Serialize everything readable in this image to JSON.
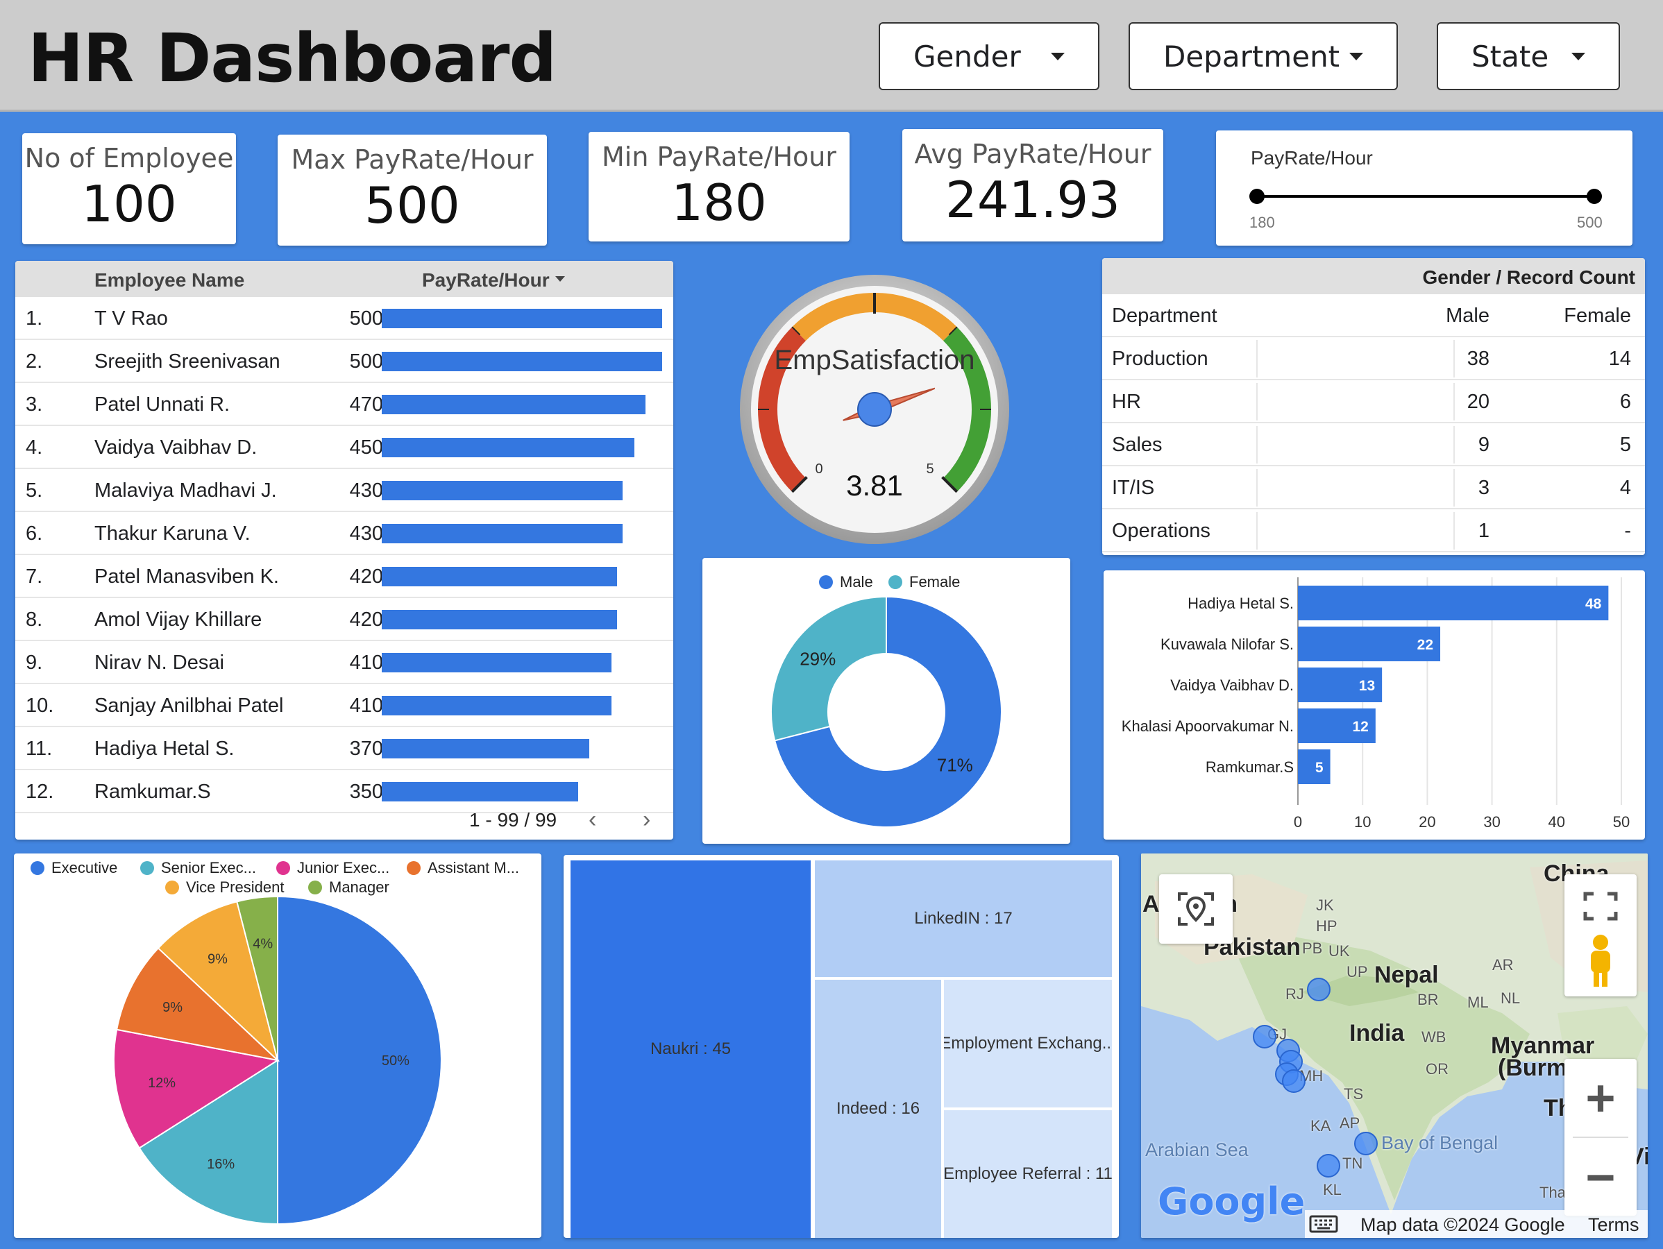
{
  "header": {
    "title": "HR Dashboard",
    "filters": [
      {
        "label": "Gender"
      },
      {
        "label": "Department"
      },
      {
        "label": "State"
      }
    ]
  },
  "kpis": [
    {
      "label": "No of Employee",
      "value": "100"
    },
    {
      "label": "Max PayRate/Hour",
      "value": "500"
    },
    {
      "label": "Min PayRate/Hour",
      "value": "180"
    },
    {
      "label": "Avg PayRate/Hour",
      "value": "241.93"
    }
  ],
  "slider": {
    "label": "PayRate/Hour",
    "min": "180",
    "max": "500"
  },
  "pay_table": {
    "col_name": "Employee Name",
    "col_pay": "PayRate/Hour",
    "sort_icon": "caret-down-icon",
    "max_value": 500,
    "rows": [
      {
        "no": "1.",
        "name": "T V Rao",
        "pay": 500
      },
      {
        "no": "2.",
        "name": "Sreejith Sreenivasan",
        "pay": 500
      },
      {
        "no": "3.",
        "name": "Patel Unnati R.",
        "pay": 470
      },
      {
        "no": "4.",
        "name": "Vaidya Vaibhav D.",
        "pay": 450
      },
      {
        "no": "5.",
        "name": "Malaviya Madhavi J.",
        "pay": 430
      },
      {
        "no": "6.",
        "name": "Thakur Karuna V.",
        "pay": 430
      },
      {
        "no": "7.",
        "name": "Patel Manasviben K.",
        "pay": 420
      },
      {
        "no": "8.",
        "name": "Amol Vijay Khillare",
        "pay": 420
      },
      {
        "no": "9.",
        "name": "Nirav N. Desai",
        "pay": 410
      },
      {
        "no": "10.",
        "name": "Sanjay Anilbhai Patel",
        "pay": 410
      },
      {
        "no": "11.",
        "name": "Hadiya Hetal S.",
        "pay": 370
      },
      {
        "no": "12.",
        "name": "Ramkumar.S",
        "pay": 350
      }
    ],
    "pagination": "1 - 99 / 99"
  },
  "gauge": {
    "label": "EmpSatisfaction",
    "value": 3.81,
    "value_text": "3.81",
    "min": "0",
    "max": "5",
    "colors": [
      "#d0432b",
      "#f0a030",
      "#43a035"
    ]
  },
  "gender_table": {
    "header": "Gender / Record Count",
    "col_dept": "Department",
    "col_male": "Male",
    "col_female": "Female",
    "rows": [
      {
        "dept": "Production",
        "male": "38",
        "female": "14"
      },
      {
        "dept": "HR",
        "male": "20",
        "female": "6"
      },
      {
        "dept": "Sales",
        "male": "9",
        "female": "5"
      },
      {
        "dept": "IT/IS",
        "male": "3",
        "female": "4"
      },
      {
        "dept": "Operations",
        "male": "1",
        "female": "-"
      }
    ]
  },
  "chart_data": [
    {
      "type": "pie",
      "variant": "donut",
      "legend_position": "top",
      "labels": [
        "Male",
        "Female"
      ],
      "values": [
        71,
        29
      ],
      "value_labels": [
        "71%",
        "29%"
      ],
      "colors": [
        "#3477e0",
        "#4fb3c8"
      ]
    },
    {
      "type": "bar",
      "orientation": "horizontal",
      "categories": [
        "Hadiya Hetal S.",
        "Kuvawala Nilofar S.",
        "Vaidya Vaibhav D.",
        "Khalasi Apoorvakumar N.",
        "Ramkumar.S"
      ],
      "values": [
        48,
        22,
        13,
        12,
        5
      ],
      "xlim": [
        0,
        50
      ],
      "xticks": [
        "0",
        "10",
        "20",
        "30",
        "40",
        "50"
      ],
      "grid": true,
      "color": "#3477e0"
    },
    {
      "type": "pie",
      "legend_position": "top",
      "labels": [
        "Executive",
        "Senior Exec...",
        "Junior Exec...",
        "Assistant M...",
        "Vice President",
        "Manager"
      ],
      "values": [
        50,
        16,
        12,
        9,
        9,
        4
      ],
      "value_labels": [
        "50%",
        "16%",
        "12%",
        "9%",
        "9%",
        "4%"
      ],
      "colors": [
        "#3477e0",
        "#4fb3c8",
        "#e0338f",
        "#e8722e",
        "#f4aa38",
        "#86b04a"
      ]
    },
    {
      "type": "treemap",
      "items": [
        {
          "name": "Naukri",
          "value": 45,
          "label": "Naukri : 45"
        },
        {
          "name": "LinkedIN",
          "value": 17,
          "label": "LinkedIN : 17"
        },
        {
          "name": "Indeed",
          "value": 16,
          "label": "Indeed : 16"
        },
        {
          "name": "Employment Exchange",
          "value": 11,
          "label": "Employment Exchang..."
        },
        {
          "name": "Employee Referral",
          "value": 11,
          "label": "Employee Referral : 11"
        }
      ],
      "colors": [
        "#3174e6",
        "#b1cdf5",
        "#b8d2f5",
        "#d4e4fa",
        "#d4e4fa"
      ]
    }
  ],
  "map": {
    "labels": [
      {
        "text": "Pakistan",
        "size": "big"
      },
      {
        "text": "Nepal",
        "size": "big"
      },
      {
        "text": "India",
        "size": "big"
      },
      {
        "text": "Myanmar",
        "size": "big"
      },
      {
        "text": "(Burm",
        "size": "big"
      },
      {
        "text": "China",
        "size": "big"
      },
      {
        "text": "Af",
        "size": "big"
      },
      {
        "text": "tan",
        "size": "big"
      },
      {
        "text": "Th",
        "size": "big"
      },
      {
        "text": "Vi",
        "size": "big"
      },
      {
        "text": "Arabian Sea",
        "size": "sea"
      },
      {
        "text": "Bay of Bengal",
        "size": "sea"
      },
      {
        "text": "Thailand",
        "size": "small"
      },
      {
        "text": "JK",
        "size": "small"
      },
      {
        "text": "HP",
        "size": "small"
      },
      {
        "text": "PB",
        "size": "small"
      },
      {
        "text": "UK",
        "size": "small"
      },
      {
        "text": "UP",
        "size": "small"
      },
      {
        "text": "RJ",
        "size": "small"
      },
      {
        "text": "BR",
        "size": "small"
      },
      {
        "text": "ML",
        "size": "small"
      },
      {
        "text": "NL",
        "size": "small"
      },
      {
        "text": "AR",
        "size": "small"
      },
      {
        "text": "GJ",
        "size": "small"
      },
      {
        "text": "WB",
        "size": "small"
      },
      {
        "text": "MH",
        "size": "small"
      },
      {
        "text": "OR",
        "size": "small"
      },
      {
        "text": "TS",
        "size": "small"
      },
      {
        "text": "KA",
        "size": "small"
      },
      {
        "text": "AP",
        "size": "small"
      },
      {
        "text": "TN",
        "size": "small"
      },
      {
        "text": "KL",
        "size": "small"
      }
    ],
    "attribution": "Map data ©2024 Google",
    "terms": "Terms",
    "logo": "Google",
    "locate_icon": "location-pin-icon",
    "fullscreen_icon": "fullscreen-icon",
    "pegman_icon": "pegman-icon",
    "zoom_in": "+",
    "zoom_out": "−",
    "keyboard_icon": "keyboard-icon"
  }
}
